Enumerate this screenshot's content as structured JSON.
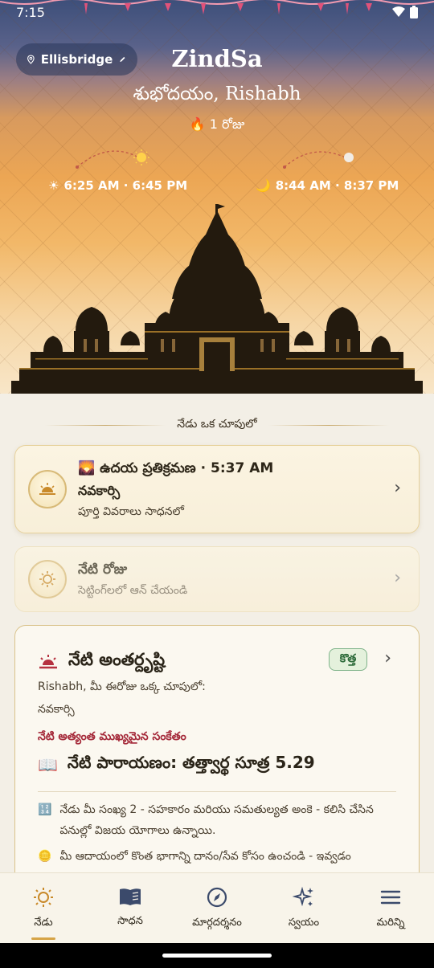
{
  "status_bar": {
    "time": "7:15"
  },
  "header": {
    "location": "Ellisbridge",
    "app_title": "ZindSa",
    "greeting": "శుభోదయం, Rishabh",
    "streak_text": "1 రోజు"
  },
  "sun": {
    "times": "6:25 AM · 6:45 PM"
  },
  "moon": {
    "times": "8:44 AM · 8:37 PM"
  },
  "section": {
    "title": "నేడు ఒక చూపులో"
  },
  "card_pratikraman": {
    "title": "ఉదయ ప్రతిక్రమణ · 5:37 AM",
    "subtitle": "నవకార్సి",
    "detail": "పూర్తి వివరాలు సాధనలో"
  },
  "card_fast": {
    "title": "నేటి రోజు",
    "subtitle": "సెట్టింగ్‌లలో ఆన్ చేయండి"
  },
  "insight": {
    "title": "నేటి అంతర్దృష్టి",
    "badge": "కొత్త",
    "line1": "Rishabh, మీ ఈరోజు ఒక్క చూపులో:",
    "line2": "నవకార్సి",
    "important_label": "నేటి అత్యంత ముఖ్యమైన సంకేతం",
    "reading": "నేటి పారాయణం: తత్త్వార్థ సూత్ర 5.29",
    "note1": "నేడు మీ సంఖ్య 2 - సహకారం మరియు సమతుల్యత అంకె - కలిసి చేసిన పనుల్లో విజయ యోగాలు ఉన్నాయి.",
    "note2": "మీ ఆదాయంలో కొంత భాగాన్ని దానం/సేవ కోసం ఉంచండి - ఇవ్వడం"
  },
  "nav": [
    {
      "label": "నేడు",
      "icon": "sun-icon",
      "active": true
    },
    {
      "label": "సాధన",
      "icon": "book-icon",
      "active": false
    },
    {
      "label": "మార్గదర్శనం",
      "icon": "compass-icon",
      "active": false
    },
    {
      "label": "స్వయం",
      "icon": "sparkles-icon",
      "active": false
    },
    {
      "label": "మరిన్ని",
      "icon": "menu-icon",
      "active": false
    }
  ],
  "colors": {
    "accent": "#d6a447",
    "important": "#a52a3a",
    "badge_green": "#2d6b3a"
  }
}
